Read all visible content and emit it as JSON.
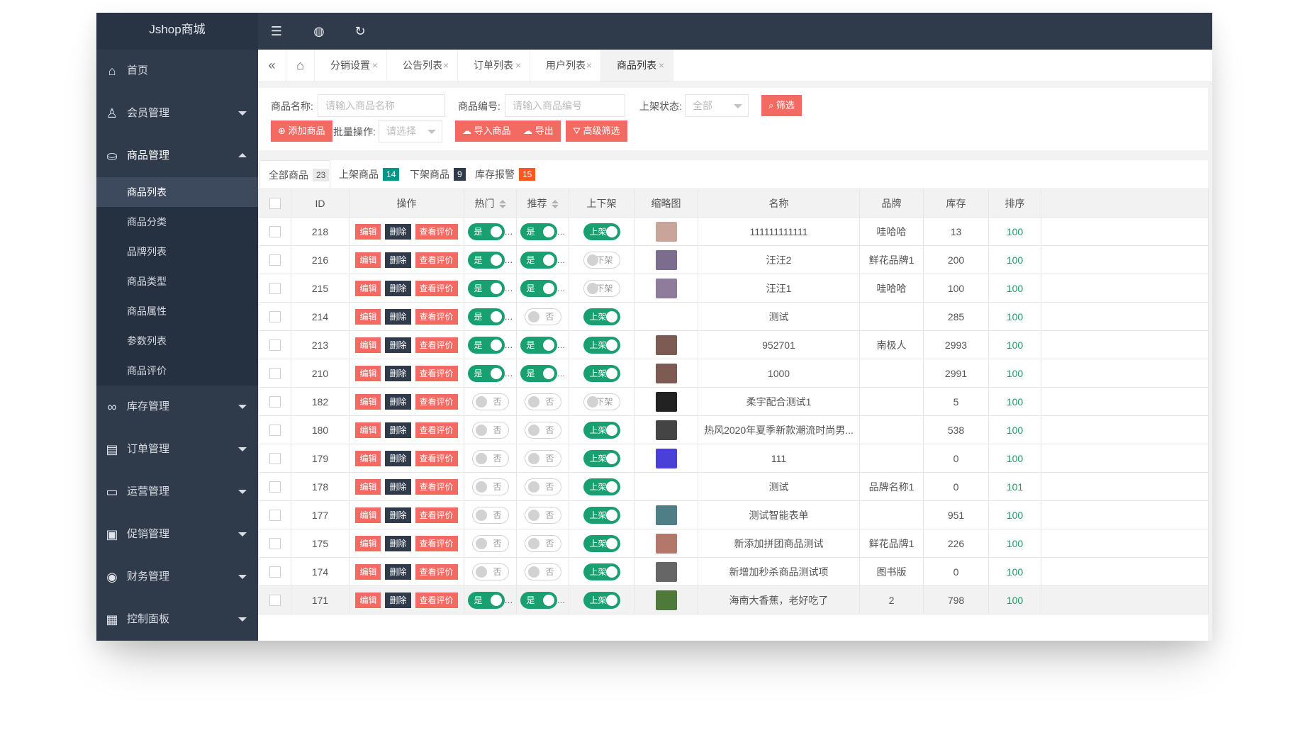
{
  "app": {
    "logo": "Jshop商城"
  },
  "header": {
    "icons": [
      "menu-fold-icon",
      "globe-icon",
      "refresh-icon"
    ]
  },
  "sidebar": {
    "items": [
      {
        "label": "首页",
        "icon": "home-icon",
        "arrow": false
      },
      {
        "label": "会员管理",
        "icon": "user-icon",
        "arrow": "down"
      },
      {
        "label": "商品管理",
        "icon": "bag-icon",
        "arrow": "up"
      },
      {
        "label": "库存管理",
        "icon": "link-icon",
        "arrow": "down"
      },
      {
        "label": "订单管理",
        "icon": "order-icon",
        "arrow": "down"
      },
      {
        "label": "运营管理",
        "icon": "monitor-icon",
        "arrow": "down"
      },
      {
        "label": "促销管理",
        "icon": "promo-icon",
        "arrow": "down"
      },
      {
        "label": "财务管理",
        "icon": "finance-icon",
        "arrow": "down"
      },
      {
        "label": "控制面板",
        "icon": "dashboard-icon",
        "arrow": "down"
      }
    ],
    "submenu": [
      "商品列表",
      "商品分类",
      "品牌列表",
      "商品类型",
      "商品属性",
      "参数列表",
      "商品评价"
    ],
    "active_sub": "商品列表"
  },
  "tabs": [
    "分销设置",
    "公告列表",
    "订单列表",
    "用户列表",
    "商品列表"
  ],
  "tab_close": "×",
  "filter": {
    "name_label": "商品名称:",
    "name_placeholder": "请输入商品名称",
    "code_label": "商品编号:",
    "code_placeholder": "请输入商品编号",
    "status_label": "上架状态:",
    "status_value": "全部",
    "filter_btn": "筛选",
    "add_btn": "添加商品",
    "batch_label": "批量操作:",
    "batch_value": "请选择",
    "import_btn": "导入商品",
    "export_btn": "导出",
    "advanced_btn": "高级筛选"
  },
  "subtabs": [
    {
      "label": "全部商品",
      "count": "23",
      "color": "#e8e8e8",
      "textcolor": "#555"
    },
    {
      "label": "上架商品",
      "count": "14",
      "color": "#009688",
      "textcolor": "#fff"
    },
    {
      "label": "下架商品",
      "count": "9",
      "color": "#2f3a4b",
      "textcolor": "#fff"
    },
    {
      "label": "库存报警",
      "count": "15",
      "color": "#ff5722",
      "textcolor": "#fff"
    }
  ],
  "columns": [
    "ID",
    "操作",
    "热门",
    "推荐",
    "上下架",
    "缩略图",
    "名称",
    "品牌",
    "库存",
    "排序"
  ],
  "ops": {
    "edit": "编辑",
    "delete": "删除",
    "review": "查看评价"
  },
  "switch_text": {
    "yes": "是",
    "no": "否",
    "on": "上架",
    "off": "下架",
    "ellipsis": "…"
  },
  "rows": [
    {
      "id": "218",
      "hot": true,
      "rec": true,
      "shelf": true,
      "thumb": "#c9a49b",
      "name": "111111111111",
      "brand": "哇哈哈",
      "stock": "13",
      "sort": "100"
    },
    {
      "id": "216",
      "hot": true,
      "rec": true,
      "shelf": false,
      "thumb": "#7a6d8e",
      "name": "汪汪2",
      "brand": "鲜花品牌1",
      "stock": "200",
      "sort": "100"
    },
    {
      "id": "215",
      "hot": true,
      "rec": true,
      "shelf": false,
      "thumb": "#8f7c9c",
      "name": "汪汪1",
      "brand": "哇哈哈",
      "stock": "100",
      "sort": "100"
    },
    {
      "id": "214",
      "hot": true,
      "rec": false,
      "shelf": true,
      "thumb": "",
      "name": "测试",
      "brand": "",
      "stock": "285",
      "sort": "100"
    },
    {
      "id": "213",
      "hot": true,
      "rec": true,
      "shelf": true,
      "thumb": "#7d5a52",
      "name": "952701",
      "brand": "南极人",
      "stock": "2993",
      "sort": "100"
    },
    {
      "id": "210",
      "hot": true,
      "rec": true,
      "shelf": true,
      "thumb": "#7d5a52",
      "name": "1000",
      "brand": "",
      "stock": "2991",
      "sort": "100"
    },
    {
      "id": "182",
      "hot": false,
      "rec": false,
      "shelf": false,
      "thumb": "#222222",
      "name": "柔宇配合测试1",
      "brand": "",
      "stock": "5",
      "sort": "100"
    },
    {
      "id": "180",
      "hot": false,
      "rec": false,
      "shelf": true,
      "thumb": "#444444",
      "name": "热风2020年夏季新款潮流时尚男...",
      "brand": "",
      "stock": "538",
      "sort": "100"
    },
    {
      "id": "179",
      "hot": false,
      "rec": false,
      "shelf": true,
      "thumb": "#4a3fd8",
      "name": "111",
      "brand": "",
      "stock": "0",
      "sort": "100"
    },
    {
      "id": "178",
      "hot": false,
      "rec": false,
      "shelf": true,
      "thumb": "",
      "name": "测试",
      "brand": "品牌名称1",
      "stock": "0",
      "sort": "101"
    },
    {
      "id": "177",
      "hot": false,
      "rec": false,
      "shelf": true,
      "thumb": "#4f7e86",
      "name": "测试智能表单",
      "brand": "",
      "stock": "951",
      "sort": "100"
    },
    {
      "id": "175",
      "hot": false,
      "rec": false,
      "shelf": true,
      "thumb": "#b4786a",
      "name": "新添加拼团商品测试",
      "brand": "鲜花品牌1",
      "stock": "226",
      "sort": "100"
    },
    {
      "id": "174",
      "hot": false,
      "rec": false,
      "shelf": true,
      "thumb": "#666666",
      "name": "新增加秒杀商品测试项",
      "brand": "图书版",
      "stock": "0",
      "sort": "100"
    },
    {
      "id": "171",
      "hot": true,
      "rec": true,
      "shelf": true,
      "thumb": "#4d7a3a",
      "name": "海南大香蕉，老好吃了",
      "brand": "2",
      "stock": "798",
      "sort": "100"
    }
  ],
  "colors": {
    "sidebar": "#2f3a4b",
    "accent_red": "#f26a62",
    "switch_green": "#18a070",
    "sort_green": "#1a9a62"
  }
}
